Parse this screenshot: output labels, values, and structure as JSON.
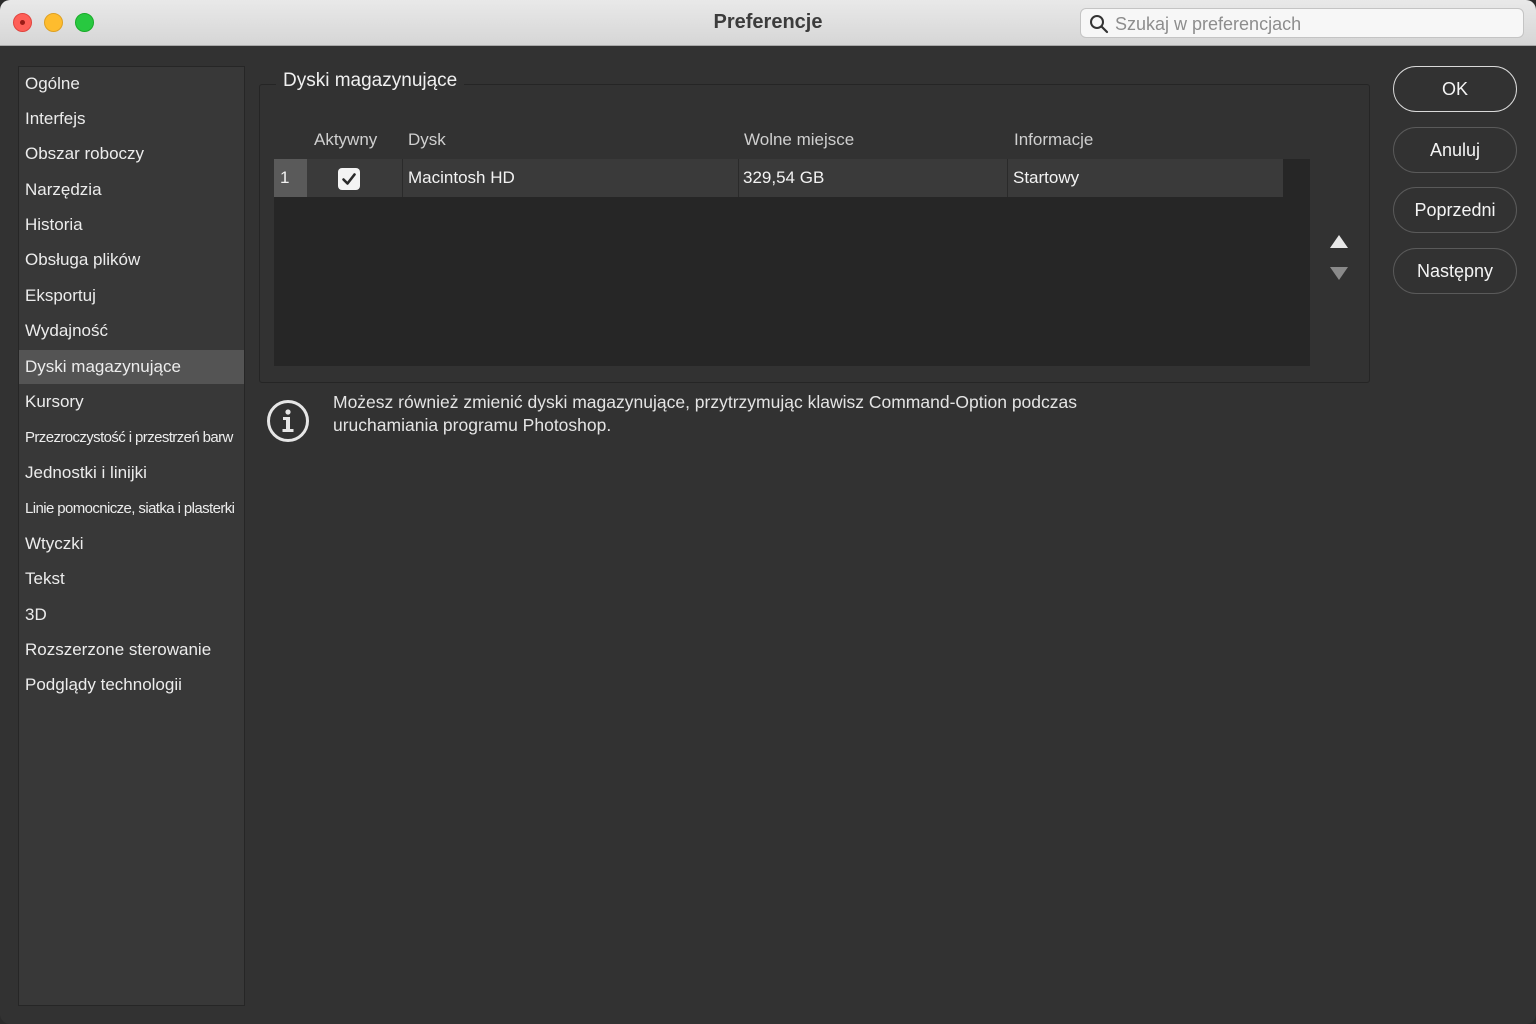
{
  "window": {
    "title": "Preferencje"
  },
  "search": {
    "placeholder": "Szukaj w preferencjach"
  },
  "sidebar": {
    "items": [
      {
        "label": "Ogólne"
      },
      {
        "label": "Interfejs"
      },
      {
        "label": "Obszar roboczy"
      },
      {
        "label": "Narzędzia"
      },
      {
        "label": "Historia"
      },
      {
        "label": "Obsługa plików"
      },
      {
        "label": "Eksportuj"
      },
      {
        "label": "Wydajność"
      },
      {
        "label": "Dyski magazynujące",
        "selected": true
      },
      {
        "label": "Kursory"
      },
      {
        "label": "Przezroczystość i przestrzeń barw"
      },
      {
        "label": "Jednostki i linijki"
      },
      {
        "label": "Linie pomocnicze, siatka i plasterki"
      },
      {
        "label": "Wtyczki"
      },
      {
        "label": "Tekst"
      },
      {
        "label": "3D"
      },
      {
        "label": "Rozszerzone sterowanie"
      },
      {
        "label": "Podglądy technologii"
      }
    ]
  },
  "scratch": {
    "group_title": "Dyski magazynujące",
    "columns": [
      "Aktywny",
      "Dysk",
      "Wolne miejsce",
      "Informacje"
    ],
    "rows": [
      {
        "index": "1",
        "active": true,
        "disk": "Macintosh HD",
        "free": "329,54 GB",
        "info": "Startowy"
      }
    ],
    "info_text_line1": "Możesz również zmienić dyski magazynujące, przytrzymując klawisz Command-Option podczas",
    "info_text_line2": "uruchamiania programu Photoshop."
  },
  "buttons": {
    "ok": "OK",
    "cancel": "Anuluj",
    "previous": "Poprzedni",
    "next": "Następny"
  },
  "icons": {
    "search": "search-icon",
    "info": "info-icon",
    "checkbox": "checkmark-icon",
    "move_up": "triangle-up-icon",
    "move_down": "triangle-down-icon"
  },
  "colors": {
    "background": "#323232",
    "selected_item": "#545454",
    "close": "#fe5f57",
    "minimize": "#febc2e",
    "maximize": "#28c840"
  }
}
